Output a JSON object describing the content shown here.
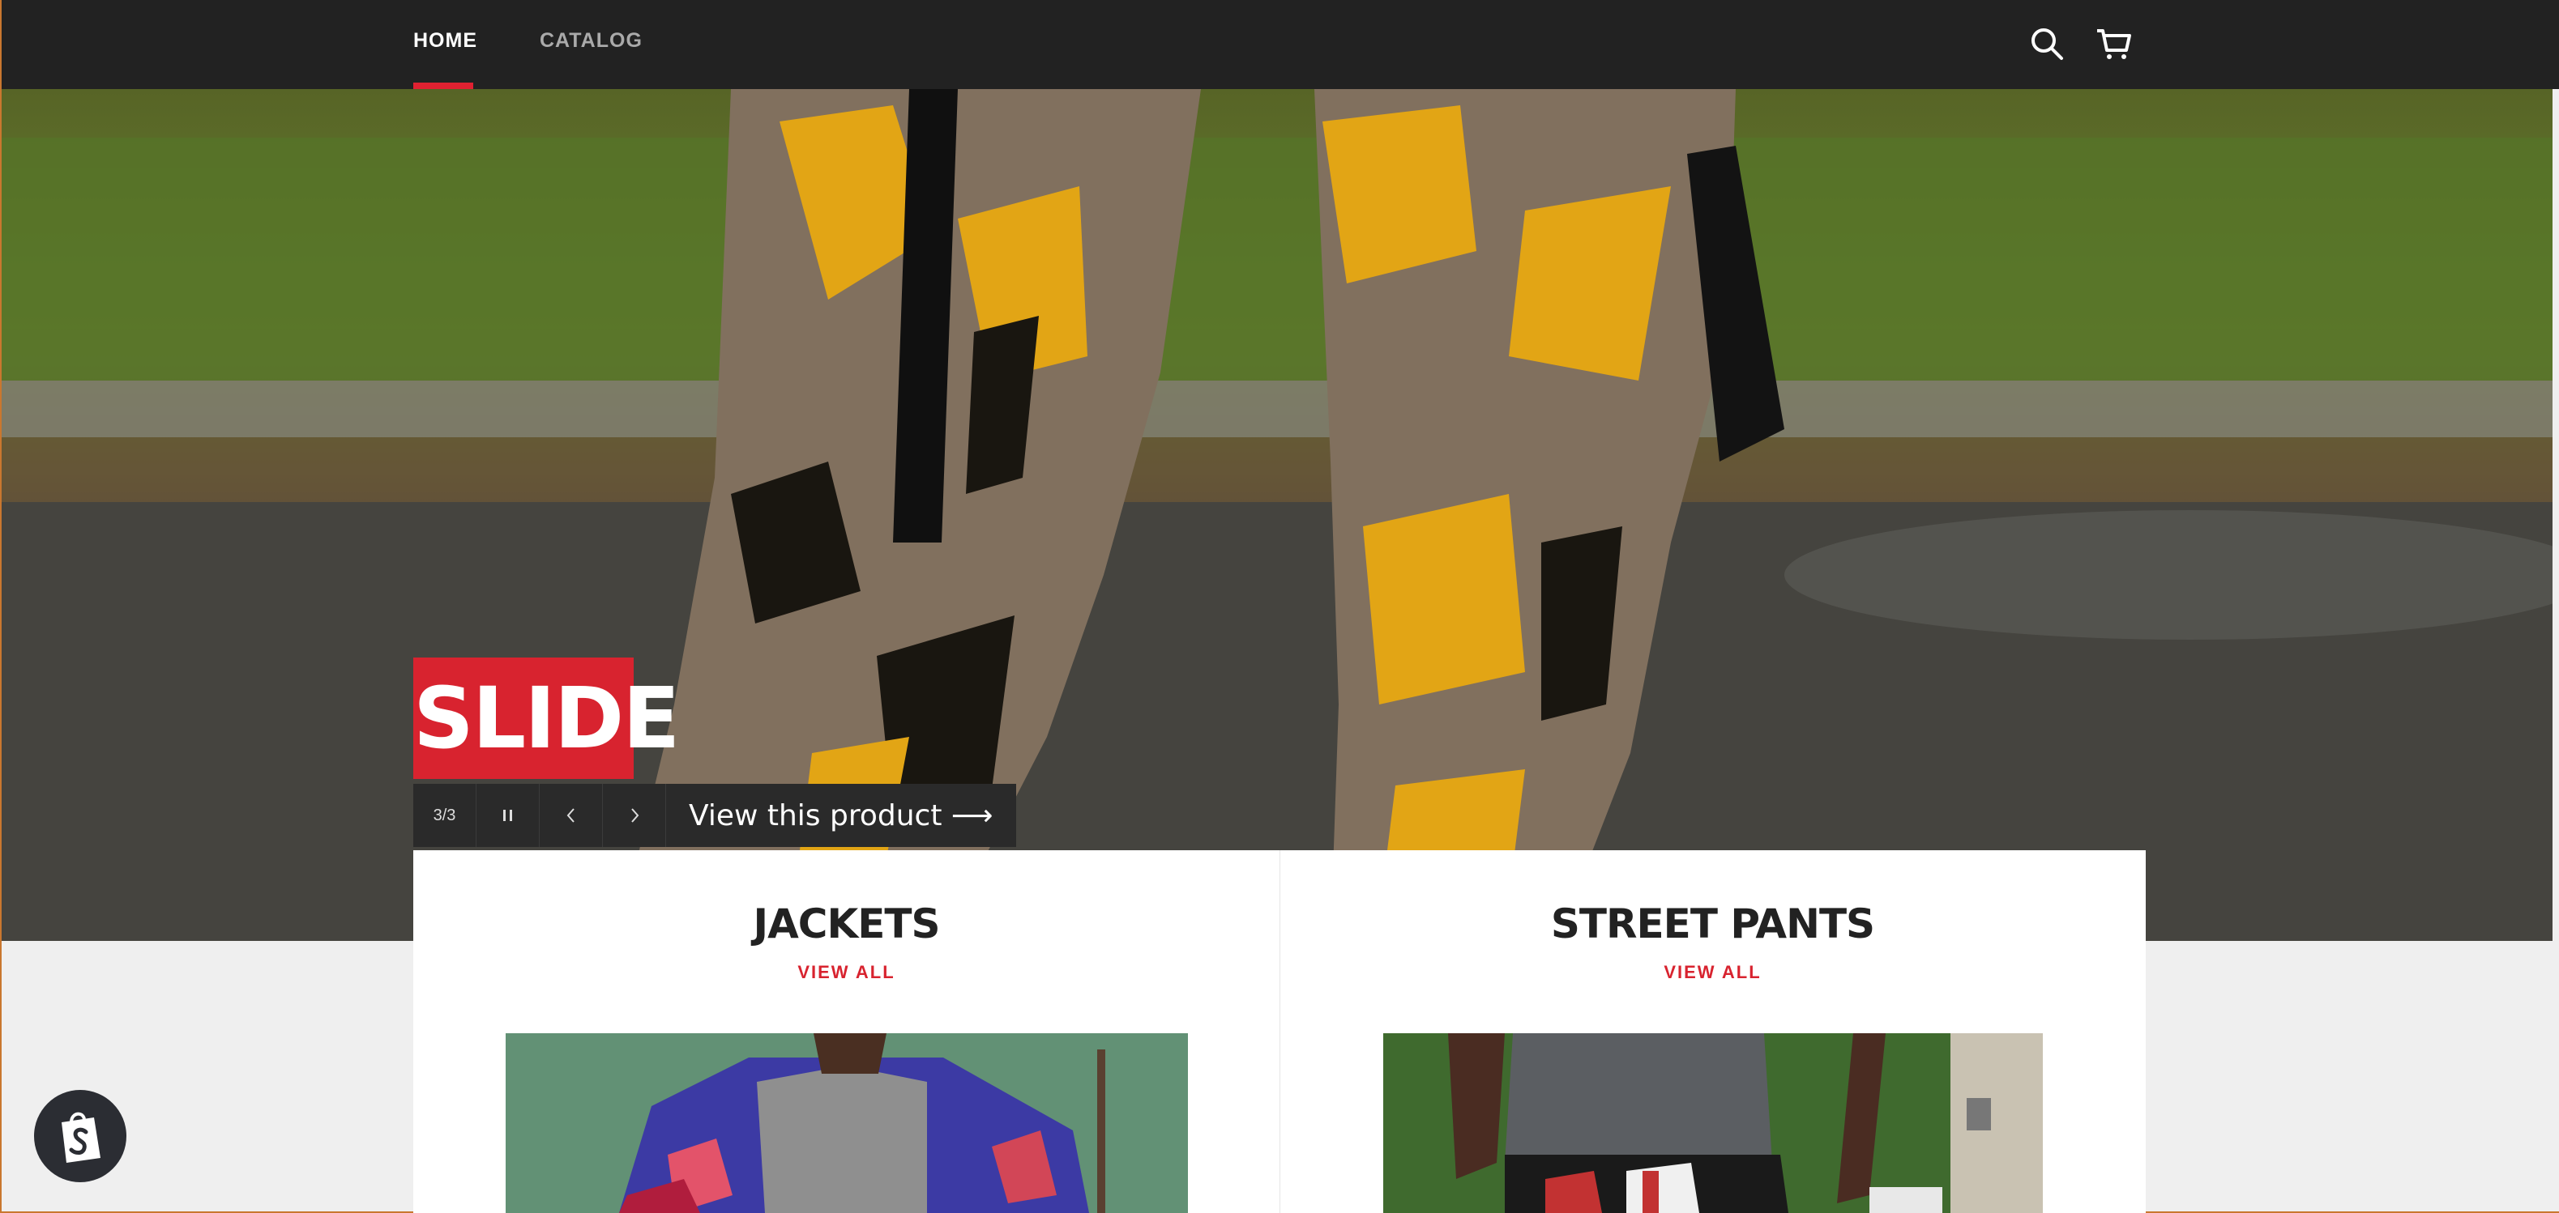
{
  "nav": {
    "home_label": "HOME",
    "catalog_label": "CATALOG",
    "search_icon": "search-icon",
    "cart_icon": "cart-icon"
  },
  "hero": {
    "slide_title": "SLIDE",
    "counter": "3/3",
    "view_product_label": "View this product ⟶"
  },
  "collections": [
    {
      "title": "JACKETS",
      "link_label": "VIEW ALL"
    },
    {
      "title": "STREET PANTS",
      "link_label": "VIEW ALL"
    }
  ],
  "colors": {
    "nav_bg": "#222222",
    "accent": "#d8232f",
    "page_bg": "#efefef"
  },
  "badge": {
    "icon": "shopify-bag-icon"
  }
}
